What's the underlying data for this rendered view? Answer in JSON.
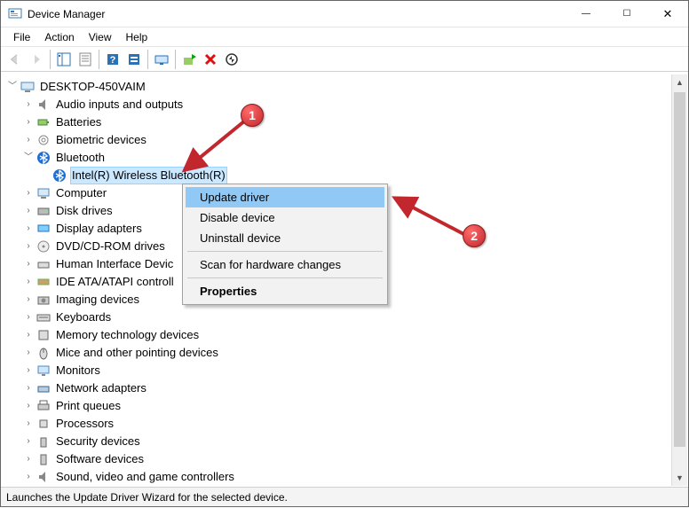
{
  "window": {
    "title": "Device Manager",
    "controls": {
      "min": "—",
      "max": "☐",
      "close": "✕"
    }
  },
  "menu": {
    "file": "File",
    "action": "Action",
    "view": "View",
    "help": "Help"
  },
  "tree": {
    "root": "DESKTOP-450VAIM",
    "items": [
      "Audio inputs and outputs",
      "Batteries",
      "Biometric devices",
      "Bluetooth",
      "Computer",
      "Disk drives",
      "Display adapters",
      "DVD/CD-ROM drives",
      "Human Interface Devic",
      "IDE ATA/ATAPI controll",
      "Imaging devices",
      "Keyboards",
      "Memory technology devices",
      "Mice and other pointing devices",
      "Monitors",
      "Network adapters",
      "Print queues",
      "Processors",
      "Security devices",
      "Software devices",
      "Sound, video and game controllers"
    ],
    "bt_child": "Intel(R) Wireless Bluetooth(R)"
  },
  "context_menu": {
    "update": "Update driver",
    "disable": "Disable device",
    "uninstall": "Uninstall device",
    "scan": "Scan for hardware changes",
    "properties": "Properties"
  },
  "status": "Launches the Update Driver Wizard for the selected device.",
  "callouts": {
    "one": "1",
    "two": "2"
  }
}
